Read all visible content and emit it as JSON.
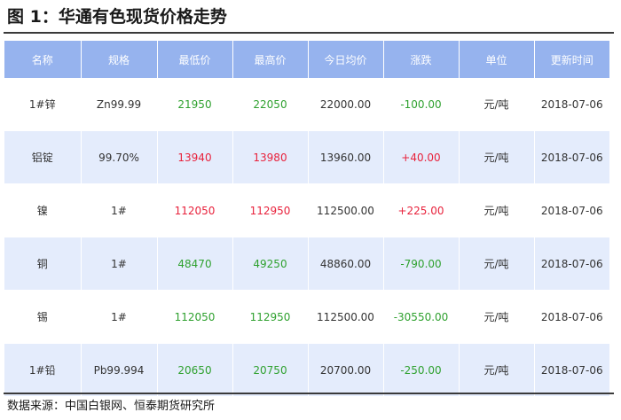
{
  "title": "图 1：华通有色现货价格走势",
  "colors": {
    "header_bg": "#96b3ee",
    "row_alt": "#e4ecfc",
    "up": "#e8223c",
    "down": "#2fa12f"
  },
  "headers": [
    "名称",
    "规格",
    "最低价",
    "最高价",
    "今日均价",
    "涨跌",
    "单位",
    "更新时间"
  ],
  "rows": [
    {
      "name": "1#锌",
      "spec": "Zn99.99",
      "low": "21950",
      "high": "22050",
      "avg": "22000.00",
      "change": "-100.00",
      "unit": "元/吨",
      "date": "2018-07-06",
      "dir": "down"
    },
    {
      "name": "铝锭",
      "spec": "99.70%",
      "low": "13940",
      "high": "13980",
      "avg": "13960.00",
      "change": "+40.00",
      "unit": "元/吨",
      "date": "2018-07-06",
      "dir": "up"
    },
    {
      "name": "镍",
      "spec": "1#",
      "low": "112050",
      "high": "112950",
      "avg": "112500.00",
      "change": "+225.00",
      "unit": "元/吨",
      "date": "2018-07-06",
      "dir": "up"
    },
    {
      "name": "铜",
      "spec": "1#",
      "low": "48470",
      "high": "49250",
      "avg": "48860.00",
      "change": "-790.00",
      "unit": "元/吨",
      "date": "2018-07-06",
      "dir": "down"
    },
    {
      "name": "锡",
      "spec": "1#",
      "low": "112050",
      "high": "112950",
      "avg": "112500.00",
      "change": "-30550.00",
      "unit": "元/吨",
      "date": "2018-07-06",
      "dir": "down"
    },
    {
      "name": "1#铅",
      "spec": "Pb99.994",
      "low": "20650",
      "high": "20750",
      "avg": "20700.00",
      "change": "-250.00",
      "unit": "元/吨",
      "date": "2018-07-06",
      "dir": "down"
    }
  ],
  "source": "数据来源：中国白银网、恒泰期货研究所"
}
